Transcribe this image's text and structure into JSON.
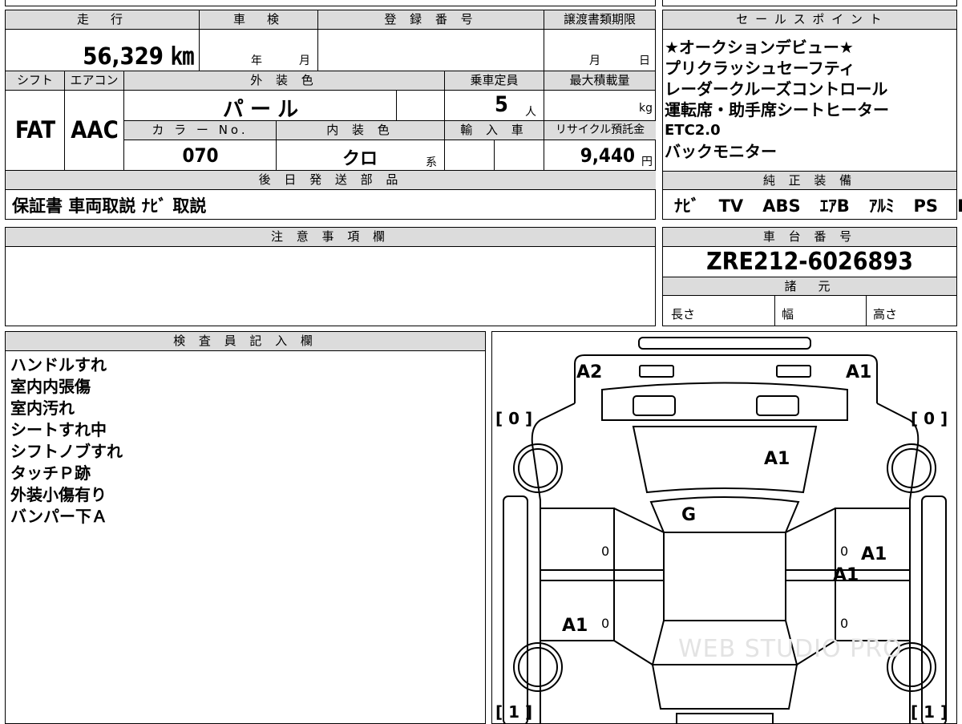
{
  "vehicle_info": {
    "mileage_label": "走　行",
    "mileage_value": "56,329 ㎞",
    "shaken_label": "車　検",
    "shaken_year": "年",
    "shaken_month": "月",
    "registration_label": "登 録 番 号",
    "transfer_deadline_label": "譲渡書類期限",
    "transfer_month": "月",
    "transfer_day": "日",
    "shift_label": "シフト",
    "shift_value": "FAT",
    "aircon_label": "エアコン",
    "aircon_value": "AAC",
    "exterior_color_label": "外 装 色",
    "exterior_color_value": "パ ー ル",
    "capacity_label": "乗車定員",
    "capacity_value": "5",
    "capacity_unit": "人",
    "max_load_label": "最大積載量",
    "max_load_unit": "kg",
    "color_no_label": "カ ラ ー No.",
    "color_no_value": "070",
    "interior_color_label": "内 装 色",
    "interior_color_value": "クロ",
    "interior_color_suffix": "系",
    "import_label": "輸 入 車",
    "recycle_label": "リサイクル預託金",
    "recycle_value": "9,440",
    "recycle_unit": "円",
    "later_parts_label": "後 日 発 送 部 品",
    "later_parts_value": "保証書 車両取説 ﾅﾋﾞ 取説"
  },
  "sales_points": {
    "label": "セ ー ル ス ポ イ ン ト",
    "lines": [
      "★オークションデビュー★",
      "プリクラッシュセーフティ",
      "レーダークルーズコントロール",
      "運転席・助手席シートヒーター",
      "ETC2.0",
      "バックモニター"
    ]
  },
  "equipment": {
    "label": "純 正 装 備",
    "items": [
      "ﾅﾋﾞ",
      "TV",
      "ABS",
      "ｴｱB",
      "ｱﾙﾐ",
      "PS",
      "PW"
    ]
  },
  "notes": {
    "label": "注 意 事 項 欄"
  },
  "chassis": {
    "label": "車 台 番 号",
    "value": "ZRE212-6026893",
    "specs_label": "諸　元",
    "length_label": "長さ",
    "width_label": "幅",
    "height_label": "高さ"
  },
  "inspector": {
    "label": "検 査 員 記 入 欄",
    "lines": [
      "ハンドルすれ",
      "室内内張傷",
      "室内汚れ",
      "シートすれ中",
      "シフトノブすれ",
      "タッチＰ跡",
      "外装小傷有り",
      "バンパー下Ａ"
    ]
  },
  "diagram": {
    "marks": {
      "front_left": "A2",
      "front_right": "A1",
      "hood": "A1",
      "windshield": "G",
      "right_front_door": "A1",
      "right_rear_door": "A1",
      "left_rear_door": "A1"
    },
    "tires": {
      "front_left": "0",
      "front_right": "0",
      "rear_left": "1",
      "rear_right": "1"
    },
    "door_marks": [
      "0",
      "0",
      "0",
      "0"
    ],
    "watermark": "WEB STUDIO PRO"
  }
}
